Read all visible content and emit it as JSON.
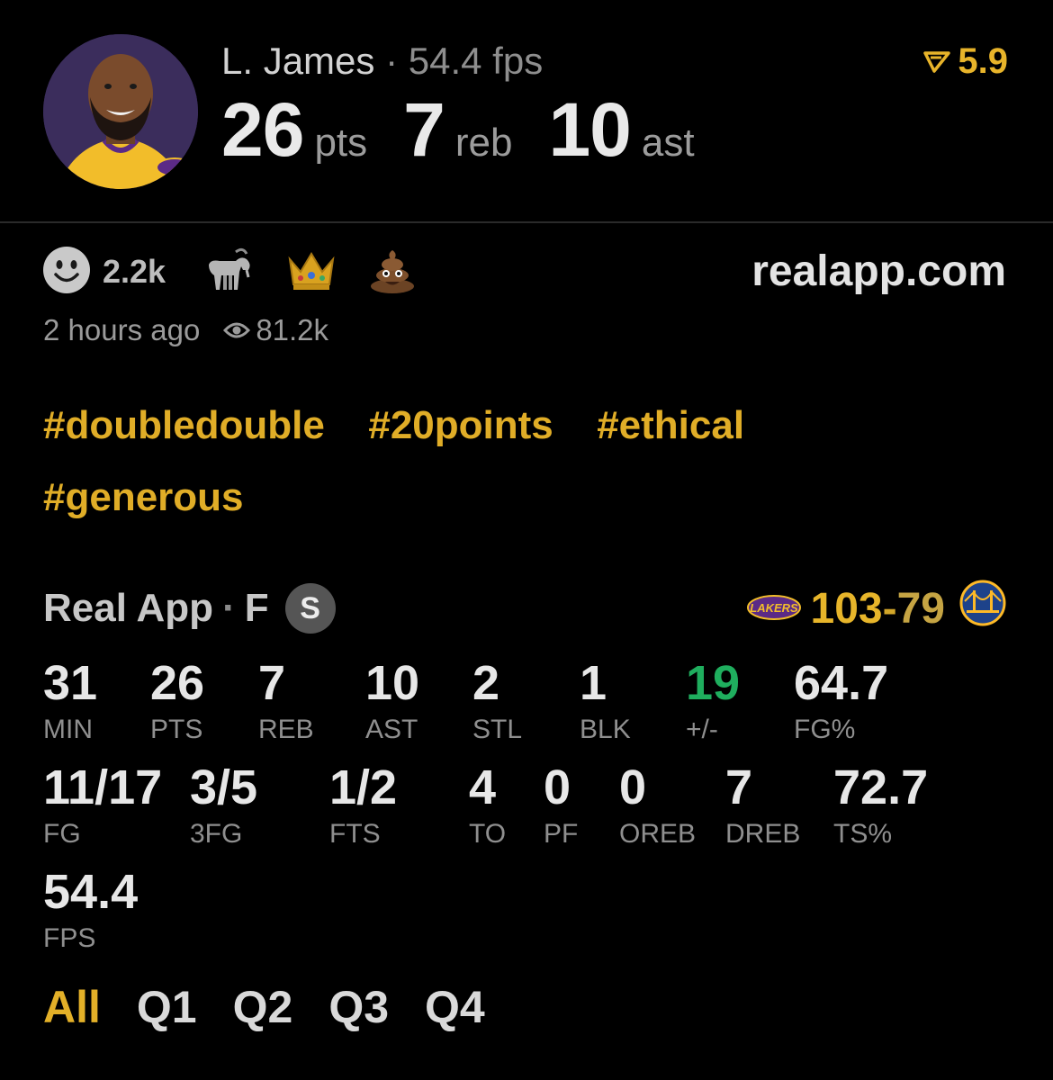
{
  "header": {
    "player_name": "L. James",
    "separator": "·",
    "fps_label": "54.4 fps",
    "points": "26",
    "points_unit": "pts",
    "rebounds": "7",
    "rebounds_unit": "reb",
    "assists": "10",
    "assists_unit": "ast",
    "rating": "5.9"
  },
  "reactions": {
    "smiley_count": "2.2k",
    "emojis": [
      "goat-icon",
      "crown-icon",
      "poop-icon"
    ]
  },
  "site": "realapp.com",
  "meta": {
    "time_ago": "2 hours ago",
    "views": "81.2k"
  },
  "tags": [
    "#doubledouble",
    "#20points",
    "#ethical",
    "#generous"
  ],
  "game": {
    "source": "Real App",
    "separator": "·",
    "status": "F",
    "badge": "S",
    "home_score": "103",
    "dash": "-",
    "away_score": "79"
  },
  "stats": [
    {
      "value": "31",
      "label": "MIN"
    },
    {
      "value": "26",
      "label": "PTS"
    },
    {
      "value": "7",
      "label": "REB"
    },
    {
      "value": "10",
      "label": "AST"
    },
    {
      "value": "2",
      "label": "STL"
    },
    {
      "value": "1",
      "label": "BLK"
    },
    {
      "value": "19",
      "label": "+/-"
    },
    {
      "value": "64.7",
      "label": "FG%"
    },
    {
      "value": "11/17",
      "label": "FG"
    },
    {
      "value": "3/5",
      "label": "3FG"
    },
    {
      "value": "1/2",
      "label": "FTS"
    },
    {
      "value": "4",
      "label": "TO"
    },
    {
      "value": "0",
      "label": "PF"
    },
    {
      "value": "0",
      "label": "OREB"
    },
    {
      "value": "7",
      "label": "DREB"
    },
    {
      "value": "72.7",
      "label": "TS%"
    },
    {
      "value": "54.4",
      "label": "FPS"
    }
  ],
  "tabs": [
    "All",
    "Q1",
    "Q2",
    "Q3",
    "Q4"
  ],
  "colors": {
    "accent": "#e3b028",
    "positive": "#1fae5e",
    "background": "#000000"
  }
}
